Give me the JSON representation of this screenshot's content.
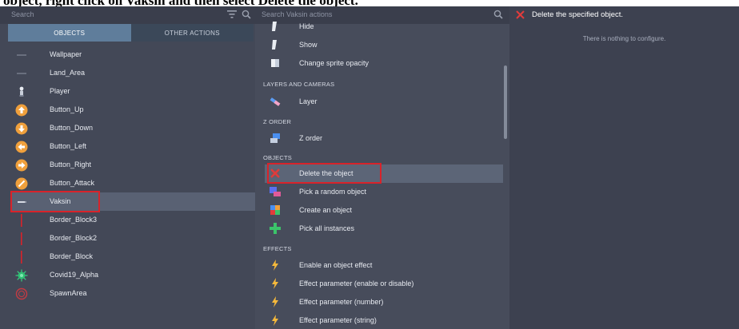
{
  "top_caption": "object, right click on Vaksin and then select Delete the object.",
  "left_panel": {
    "search_placeholder": "Search",
    "tabs": [
      {
        "label": "OBJECTS",
        "active": true
      },
      {
        "label": "OTHER ACTIONS",
        "active": false
      }
    ],
    "objects": [
      {
        "label": "Wallpaper",
        "icon": "line-icon"
      },
      {
        "label": "Land_Area",
        "icon": "line-icon"
      },
      {
        "label": "Player",
        "icon": "player-icon"
      },
      {
        "label": "Button_Up",
        "icon": "arrow-up-circle-icon"
      },
      {
        "label": "Button_Down",
        "icon": "arrow-down-circle-icon"
      },
      {
        "label": "Button_Left",
        "icon": "arrow-left-circle-icon"
      },
      {
        "label": "Button_Right",
        "icon": "arrow-right-circle-icon"
      },
      {
        "label": "Button_Attack",
        "icon": "sword-circle-icon"
      },
      {
        "label": "Vaksin",
        "icon": "syringe-icon",
        "selected": true
      },
      {
        "label": "Border_Block3",
        "icon": "red-bar-icon"
      },
      {
        "label": "Border_Block2",
        "icon": "red-bar-icon"
      },
      {
        "label": "Border_Block",
        "icon": "red-bar-icon"
      },
      {
        "label": "Covid19_Alpha",
        "icon": "virus-icon"
      },
      {
        "label": "SpawnArea",
        "icon": "spawn-circle-icon"
      }
    ]
  },
  "middle_panel": {
    "search_placeholder": "Search Vaksin actions",
    "rows": [
      {
        "kind": "action",
        "label": "Hide",
        "icon": "eye-icon"
      },
      {
        "kind": "action",
        "label": "Show",
        "icon": "eye-icon"
      },
      {
        "kind": "action",
        "label": "Change sprite opacity",
        "icon": "opacity-icon"
      },
      {
        "kind": "section",
        "label": "LAYERS AND CAMERAS"
      },
      {
        "kind": "action",
        "label": "Layer",
        "icon": "layer-icon"
      },
      {
        "kind": "section",
        "label": "Z ORDER"
      },
      {
        "kind": "action",
        "label": "Z order",
        "icon": "z-order-icon"
      },
      {
        "kind": "section",
        "label": "OBJECTS"
      },
      {
        "kind": "action",
        "label": "Delete the object",
        "icon": "delete-x-icon",
        "selected": true
      },
      {
        "kind": "action",
        "label": "Pick a random object",
        "icon": "pick-random-icon"
      },
      {
        "kind": "action",
        "label": "Create an object",
        "icon": "create-object-icon"
      },
      {
        "kind": "action",
        "label": "Pick all instances",
        "icon": "pick-all-icon"
      },
      {
        "kind": "section",
        "label": "EFFECTS"
      },
      {
        "kind": "action",
        "label": "Enable an object effect",
        "icon": "lightning-icon"
      },
      {
        "kind": "action",
        "label": "Effect parameter (enable or disable)",
        "icon": "lightning-icon"
      },
      {
        "kind": "action",
        "label": "Effect parameter (number)",
        "icon": "lightning-icon"
      },
      {
        "kind": "action",
        "label": "Effect parameter (string)",
        "icon": "lightning-icon"
      }
    ]
  },
  "right_panel": {
    "title": "Delete the specified object.",
    "message": "There is nothing to configure."
  },
  "colors": {
    "highlight": "#d8232a",
    "active_tab": "#5f7d9b",
    "orange_button": "#f0a03c",
    "lightning": "#f6b93b"
  }
}
